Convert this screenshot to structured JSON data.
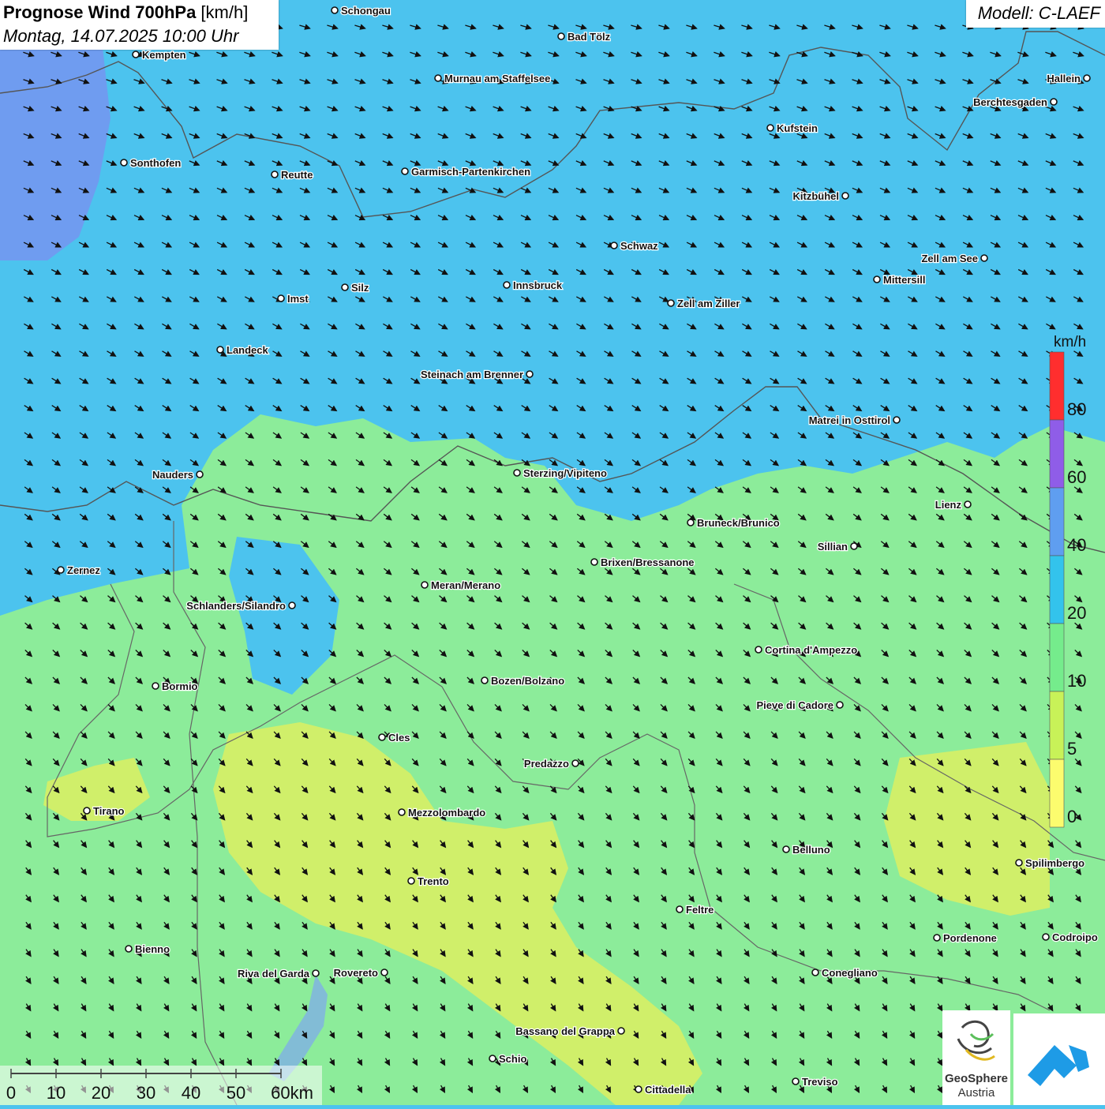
{
  "header": {
    "title_bold": "Prognose Wind 700hPa",
    "title_unit": " [km/h]",
    "date": "Montag, 14.07.2025 10:00 Uhr",
    "model": "Modell: C-LAEF"
  },
  "legend": {
    "unit": "km/h",
    "ticks": [
      "80",
      "60",
      "40",
      "20",
      "10",
      "5",
      "0"
    ],
    "colors": [
      "#ff2e2e",
      "#8f5de8",
      "#5f9ef0",
      "#33c3ec",
      "#75ec8c",
      "#c8f258",
      "#fcfc6e"
    ]
  },
  "scalebar": {
    "labels": [
      "0",
      "10",
      "20",
      "30",
      "40",
      "50",
      "60km"
    ]
  },
  "cities": [
    {
      "name": "Schongau",
      "side": "right"
    },
    {
      "name": "Bad Tölz",
      "side": "right"
    },
    {
      "name": "Kempten",
      "side": "right"
    },
    {
      "name": "Murnau am Staffelsee",
      "side": "right"
    },
    {
      "name": "Hallein",
      "side": "left"
    },
    {
      "name": "Berchtesgaden",
      "side": "left"
    },
    {
      "name": "Kufstein",
      "side": "right"
    },
    {
      "name": "Sonthofen",
      "side": "right"
    },
    {
      "name": "Reutte",
      "side": "right"
    },
    {
      "name": "Garmisch-Partenkirchen",
      "side": "right"
    },
    {
      "name": "Kitzbühel",
      "side": "left"
    },
    {
      "name": "Schwaz",
      "side": "right"
    },
    {
      "name": "Zell am See",
      "side": "left"
    },
    {
      "name": "Innsbruck",
      "side": "right"
    },
    {
      "name": "Mittersill",
      "side": "right"
    },
    {
      "name": "Silz",
      "side": "right"
    },
    {
      "name": "Imst",
      "side": "right"
    },
    {
      "name": "Zell am Ziller",
      "side": "right"
    },
    {
      "name": "Landeck",
      "side": "right"
    },
    {
      "name": "Steinach am Brenner",
      "side": "left"
    },
    {
      "name": "Matrei in Osttirol",
      "side": "left"
    },
    {
      "name": "Nauders",
      "side": "left"
    },
    {
      "name": "Sterzing/Vipiteno",
      "side": "right"
    },
    {
      "name": "Lienz",
      "side": "left"
    },
    {
      "name": "Bruneck/Brunico",
      "side": "right"
    },
    {
      "name": "Sillian",
      "side": "left"
    },
    {
      "name": "Zernez",
      "side": "right"
    },
    {
      "name": "Brixen/Bressanone",
      "side": "right"
    },
    {
      "name": "Meran/Merano",
      "side": "right"
    },
    {
      "name": "Schlanders/Silandro",
      "side": "left"
    },
    {
      "name": "Cortina d'Ampezzo",
      "side": "right"
    },
    {
      "name": "Bozen/Bolzano",
      "side": "right"
    },
    {
      "name": "Bormio",
      "side": "right"
    },
    {
      "name": "Pieve di Cadore",
      "side": "left"
    },
    {
      "name": "Cles",
      "side": "right"
    },
    {
      "name": "Predazzo",
      "side": "left"
    },
    {
      "name": "Tirano",
      "side": "right"
    },
    {
      "name": "Mezzolombardo",
      "side": "right"
    },
    {
      "name": "Belluno",
      "side": "right"
    },
    {
      "name": "Spilimbergo",
      "side": "right"
    },
    {
      "name": "Trento",
      "side": "right"
    },
    {
      "name": "Feltre",
      "side": "right"
    },
    {
      "name": "Pordenone",
      "side": "right"
    },
    {
      "name": "Codroipo",
      "side": "right"
    },
    {
      "name": "Bienno",
      "side": "right"
    },
    {
      "name": "Riva del Garda",
      "side": "left"
    },
    {
      "name": "Rovereto",
      "side": "left"
    },
    {
      "name": "Conegliano",
      "side": "right"
    },
    {
      "name": "Bassano del Grappa",
      "side": "left"
    },
    {
      "name": "Schio",
      "side": "right"
    },
    {
      "name": "Treviso",
      "side": "right"
    },
    {
      "name": "Cittadella",
      "side": "right"
    }
  ],
  "logos": {
    "geosphere_name": "GeoSphere",
    "geosphere_sub": "Austria"
  },
  "colors": {
    "wind_20_40": "#4cc3ee",
    "wind_40_60": "#6b95ee",
    "wind_10_20": "#8cec9a",
    "wind_5_10": "#d0ef6a",
    "border": "#555555",
    "arrow": "#111111"
  }
}
